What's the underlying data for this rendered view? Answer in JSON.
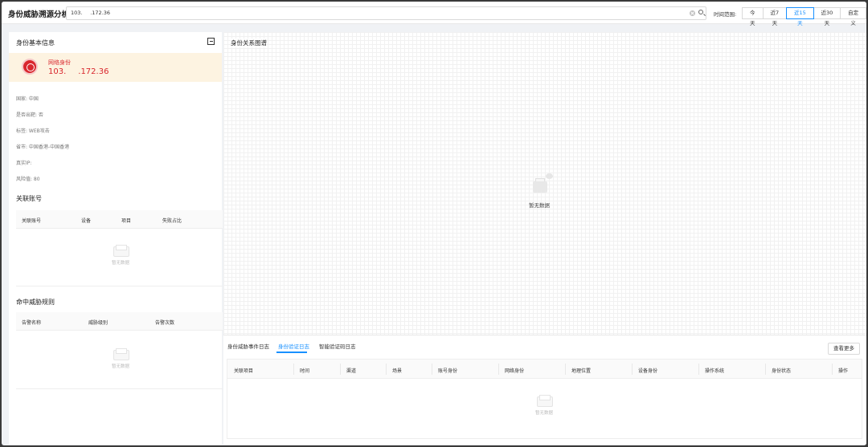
{
  "header": {
    "title": "身份威胁溯源分析",
    "search_value": "103.   .172.36",
    "time_label": "时间范围:",
    "time_options": [
      "今天",
      "近7天",
      "近15天",
      "近30天",
      "自定义"
    ],
    "active_option": "近15天"
  },
  "left": {
    "basic_title": "身份基本信息",
    "identity": {
      "type": "网络身份",
      "ip": "103.   .172.36",
      "avatar_color": "#d9272e"
    },
    "info": [
      "国家: 中国",
      "是否出靶: 否",
      "标签: WEB攻击",
      "省市: 中国香港-中国香港",
      "真实IP:",
      "风险值: 80"
    ],
    "accounts": {
      "title": "关联账号",
      "columns": [
        "关联账号",
        "设备",
        "项目",
        "失败占比"
      ],
      "empty": "暂无数据"
    },
    "rules": {
      "title": "命中威胁规则",
      "columns": [
        "告警名称",
        "威胁级别",
        "告警次数"
      ],
      "empty": "暂无数据"
    }
  },
  "right": {
    "graph_title": "身份关系图谱",
    "graph_empty": "暂无数据",
    "tabs": [
      "身份威胁事件日志",
      "身份验证日志",
      "智能验证码日志"
    ],
    "active_tab": "身份验证日志",
    "more_label": "查看更多",
    "log_columns": [
      "关联项目",
      "时间",
      "渠道",
      "场景",
      "账号身份",
      "网络身份",
      "地理位置",
      "设备身份",
      "操作系统",
      "身份状态",
      "操作"
    ],
    "log_empty": "暂无数据",
    "accent_color": "#1890ff"
  }
}
